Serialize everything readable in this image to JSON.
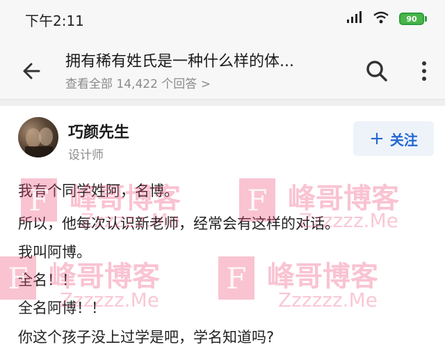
{
  "status_bar": {
    "time": "下午2:11",
    "battery": "90"
  },
  "header": {
    "question_title": "拥有稀有姓氏是一种什么样的体...",
    "answers_link": "查看全部 14,422 个回答 >"
  },
  "answer": {
    "author_name": "巧颜先生",
    "author_title": "设计师",
    "follow_label": "关注",
    "lines": [
      "我有个同学姓阿，名博。",
      "所以，他每次认识新老师，经常会有这样的对话。",
      "我叫阿博。",
      "全名！！",
      "全名阿博！！",
      "你这个孩子没上过学是吧，学名知道吗?"
    ]
  },
  "watermark": {
    "letter": "F",
    "name": "峰哥博客",
    "url": "Zzzzzz.Me"
  },
  "colors": {
    "accent": "#2367d1",
    "battery": "#49b549",
    "watermark": "#ec4875"
  },
  "icons": [
    "signal-icon",
    "wifi-icon",
    "battery-icon",
    "back-arrow-icon",
    "search-icon",
    "more-vertical-icon",
    "plus-icon"
  ]
}
